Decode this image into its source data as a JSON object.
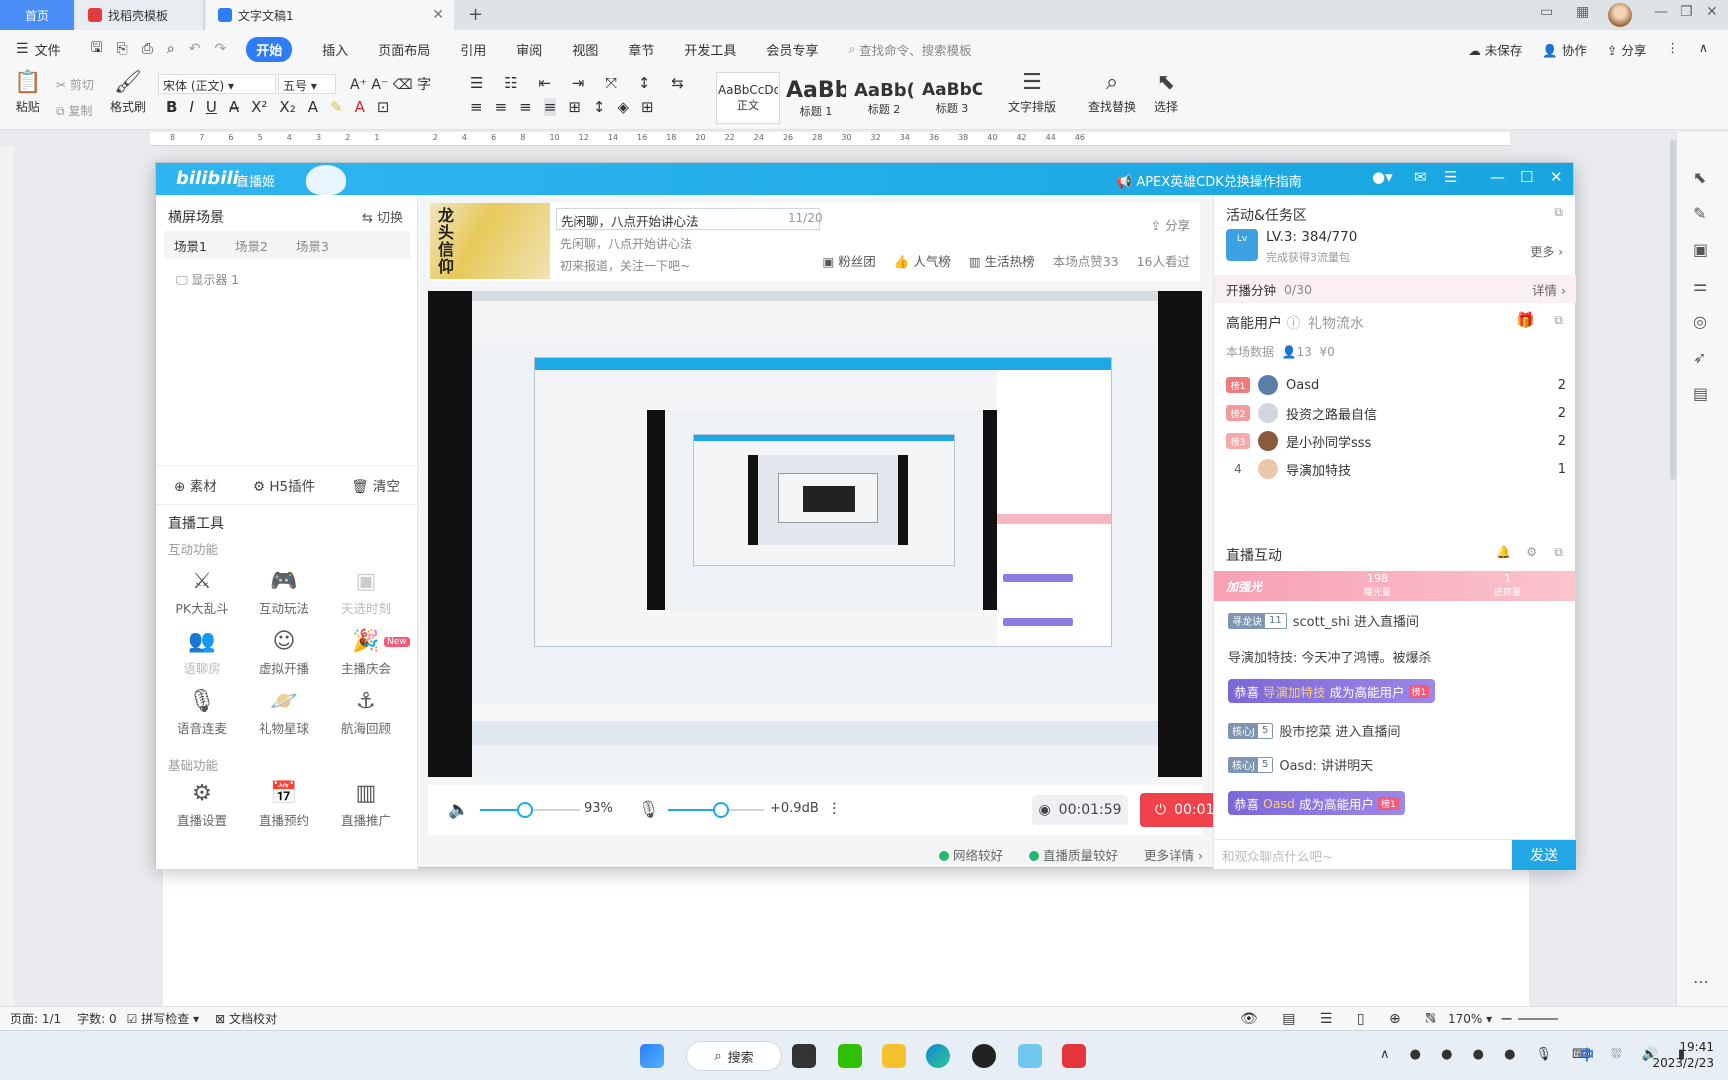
{
  "tabs": {
    "home": "首页",
    "t1": "找稻壳模板",
    "t2": "文字文稿1"
  },
  "menu": {
    "file": "文件",
    "items": [
      "开始",
      "插入",
      "页面布局",
      "引用",
      "审阅",
      "视图",
      "章节",
      "开发工具",
      "会员专享"
    ],
    "search": "查找命令、搜索模板",
    "unsaved": "未保存",
    "collab": "协作",
    "share": "分享"
  },
  "ribbon": {
    "paste": "粘贴",
    "cut": "剪切",
    "copy": "复制",
    "format_painter": "格式刷",
    "font": "宋体 (正文)",
    "size": "五号",
    "styles": [
      {
        "sample": "AaBbCcDd",
        "label": "正文"
      },
      {
        "sample": "AaBb",
        "label": "标题 1"
      },
      {
        "sample": "AaBb(",
        "label": "标题 2"
      },
      {
        "sample": "AaBbC",
        "label": "标题 3"
      }
    ],
    "text_layout": "文字排版",
    "find_replace": "查找替换",
    "select": "选择"
  },
  "ruler_ticks": [
    "8",
    "7",
    "6",
    "5",
    "4",
    "3",
    "2",
    "1",
    "",
    "2",
    "4",
    "6",
    "8",
    "10",
    "12",
    "14",
    "16",
    "18",
    "20",
    "22",
    "24",
    "26",
    "28",
    "30",
    "32",
    "34",
    "36",
    "38",
    "40",
    "42",
    "44",
    "46"
  ],
  "live": {
    "logo": "bilibili",
    "app": "直播姬",
    "notice": "APEX英雄CDK兑换操作指南",
    "left": {
      "header": "横屏场景",
      "switch": "切换",
      "scenes": [
        "场景1",
        "场景2",
        "场景3"
      ],
      "source": "显示器 1",
      "asset_buttons": [
        "素材",
        "H5插件",
        "清空"
      ],
      "tools_title": "直播工具",
      "interactive_title": "互动功能",
      "interactive_tools": [
        "PK大乱斗",
        "互动玩法",
        "天选时刻",
        "语聊房",
        "虚拟开播",
        "主播庆会",
        "语音连麦",
        "礼物星球",
        "航海回顾"
      ],
      "new_badge": "New",
      "basic_title": "基础功能",
      "basic_tools": [
        "直播设置",
        "直播预约",
        "直播推广"
      ]
    },
    "room": {
      "cover_text": "龙头信仰",
      "title": "先闲聊，八点开始讲心法",
      "title_count": "11/20",
      "line2": "先闲聊，八点开始讲心法",
      "line3": "初来报道，关注一下吧~",
      "share": "分享",
      "stats": [
        "粉丝团",
        "人气榜",
        "生活热榜",
        "本场点赞33",
        "16人看过"
      ]
    },
    "controls": {
      "speaker_volume": "93%",
      "mic_gain": "+0.9dB",
      "record_time": "00:01:59",
      "live_time": "00:01:58",
      "speaker_level": 0.45,
      "mic_level": 0.55
    },
    "net": {
      "network": "网络较好",
      "quality": "直播质量较好",
      "more": "更多详情"
    },
    "right": {
      "activity_title": "活动&任务区",
      "level": "LV.3:",
      "progress": "384/770",
      "progress_sub": "完成获得3流量包",
      "more": "更多",
      "task": "开播分钟",
      "task_progress": "0/30",
      "task_detail": "详情",
      "high_users": "高能用户",
      "gift_flow": "礼物流水",
      "session_data": "本场数据",
      "session_count": "13",
      "session_money": "¥0",
      "rank": [
        {
          "rank": "榜1",
          "name": "Oasd",
          "count": "2",
          "color": "#f07b7b"
        },
        {
          "rank": "榜2",
          "name": "投资之路最自信",
          "count": "2",
          "color": "#f39a9a"
        },
        {
          "rank": "榜3",
          "name": "是小孙同学sss",
          "count": "2",
          "color": "#f5aaaa"
        },
        {
          "rank": "4",
          "name": "导演加特技",
          "count": "1",
          "color": ""
        }
      ],
      "interact_title": "直播互动",
      "hot": "加强光",
      "exposure_num": "198",
      "exposure_label": "曝光量",
      "enter_num": "1",
      "enter_label": "进房量",
      "messages": [
        {
          "medal": "寻龙诀",
          "lvl": "11",
          "text": "scott_shi 进入直播间"
        },
        {
          "text": "导演加特技: 今天冲了鸿博。被爆杀"
        },
        {
          "pre": "恭喜",
          "who": "导演加特技",
          "post": "成为高能用户",
          "badge": "榜1"
        },
        {
          "medal": "核心J",
          "lvl": "5",
          "text": "股市挖菜 进入直播间"
        },
        {
          "medal": "核心J",
          "lvl": "5",
          "text": "Oasd: 讲讲明天"
        },
        {
          "pre": "恭喜",
          "who": "Oasd",
          "post": "成为高能用户",
          "badge": "榜1"
        }
      ],
      "input_placeholder": "和观众聊点什么吧~",
      "send": "发送"
    }
  },
  "status": {
    "page": "页面: 1/1",
    "words": "字数: 0",
    "spell": "拼写检查",
    "proof": "文档校对",
    "zoom": "170%"
  },
  "taskbar": {
    "search": "搜索",
    "time": "19:41",
    "date": "2023/2/23",
    "ime": "中"
  },
  "colors": {
    "wps_blue": "#2f7cf6",
    "bili_blue": "#22a7e6",
    "live_red": "#f0424b"
  }
}
